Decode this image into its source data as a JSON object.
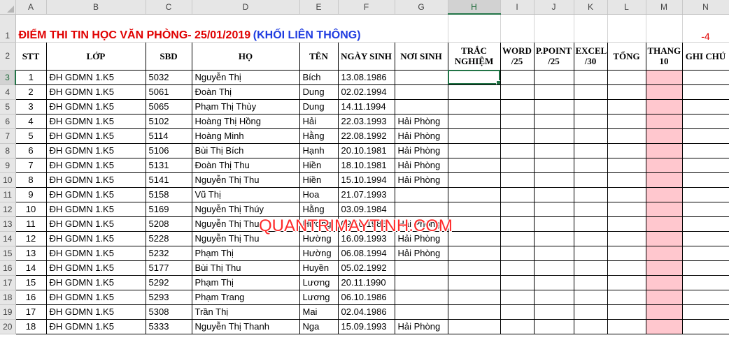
{
  "columns": [
    "A",
    "B",
    "C",
    "D",
    "E",
    "F",
    "G",
    "H",
    "I",
    "J",
    "K",
    "L",
    "M",
    "N"
  ],
  "selected_column": "H",
  "row_numbers": [
    "1",
    "2",
    "3",
    "4",
    "5",
    "6",
    "7",
    "8",
    "9",
    "10",
    "11",
    "12",
    "13",
    "14",
    "15",
    "16",
    "17",
    "18",
    "19",
    "20"
  ],
  "selected_row": "3",
  "title": {
    "red_part": "ĐIỂM THI TIN HỌC VĂN PHÒNG- 25/01/2019",
    "blue_part": "(KHỐI LIÊN THÔNG)",
    "n1_value": "-4"
  },
  "headers": [
    "STT",
    "LỚP",
    "SBD",
    "HỌ",
    "TÊN",
    "NGÀY SINH",
    "NƠI SINH",
    "TRẮC NGHIỆM",
    "WORD /25",
    "P.POINT /25",
    "EXCEL /30",
    "TỔNG",
    "THANG 10",
    "GHI CHÚ"
  ],
  "rows": [
    [
      "1",
      "ĐH GDMN 1.K5",
      "5032",
      "Nguyễn Thị",
      "Bích",
      "13.08.1986",
      ""
    ],
    [
      "2",
      "ĐH GDMN 1.K5",
      "5061",
      "Đoàn Thị",
      "Dung",
      "02.02.1994",
      ""
    ],
    [
      "3",
      "ĐH GDMN 1.K5",
      "5065",
      "Phạm Thị Thùy",
      "Dung",
      "14.11.1994",
      ""
    ],
    [
      "4",
      "ĐH GDMN 1.K5",
      "5102",
      "Hoàng Thị Hồng",
      "Hải",
      "22.03.1993",
      "Hải Phòng"
    ],
    [
      "5",
      "ĐH GDMN 1.K5",
      "5114",
      "Hoàng Minh",
      "Hằng",
      "22.08.1992",
      "Hải Phòng"
    ],
    [
      "6",
      "ĐH GDMN 1.K5",
      "5106",
      "Bùi Thị Bích",
      "Hạnh",
      "20.10.1981",
      "Hải Phòng"
    ],
    [
      "7",
      "ĐH GDMN 1.K5",
      "5131",
      "Đoàn Thị Thu",
      "Hiền",
      "18.10.1981",
      "Hải Phòng"
    ],
    [
      "8",
      "ĐH GDMN 1.K5",
      "5141",
      "Nguyễn Thị Thu",
      "Hiền",
      "15.10.1994",
      "Hải Phòng"
    ],
    [
      "9",
      "ĐH GDMN 1.K5",
      "5158",
      "Vũ Thị",
      "Hoa",
      "21.07.1993",
      ""
    ],
    [
      "10",
      "ĐH GDMN 1.K5",
      "5169",
      "Nguyễn Thị Thúy",
      "Hằng",
      "03.09.1984",
      ""
    ],
    [
      "11",
      "ĐH GDMN 1.K5",
      "5208",
      "Nguyễn Thị Thu",
      "Hương",
      "09.10.1986",
      "Hải Phòng"
    ],
    [
      "12",
      "ĐH GDMN 1.K5",
      "5228",
      "Nguyễn Thị Thu",
      "Hường",
      "16.09.1993",
      "Hải Phòng"
    ],
    [
      "13",
      "ĐH GDMN 1.K5",
      "5232",
      "Phạm Thị",
      "Hường",
      "06.08.1994",
      "Hải Phòng"
    ],
    [
      "14",
      "ĐH GDMN 1.K5",
      "5177",
      "Bùi Thị Thu",
      "Huyền",
      "05.02.1992",
      ""
    ],
    [
      "15",
      "ĐH GDMN 1.K5",
      "5292",
      "Phạm Thị",
      "Lương",
      "20.11.1990",
      ""
    ],
    [
      "16",
      "ĐH GDMN 1.K5",
      "5293",
      "Phạm Trang",
      "Lương",
      "06.10.1986",
      ""
    ],
    [
      "17",
      "ĐH GDMN 1.K5",
      "5308",
      "Trần Thị",
      "Mai",
      "02.04.1986",
      ""
    ],
    [
      "18",
      "ĐH GDMN 1.K5",
      "5333",
      "Nguyễn Thị Thanh",
      "Nga",
      "15.09.1993",
      "Hải Phòng"
    ]
  ],
  "watermark": "QUANTRIMAYTINH.COM",
  "colors": {
    "title_red": "#e00000",
    "title_blue": "#1f3ce0",
    "highlight_pink": "#ffc7ce",
    "selection_green": "#217346"
  }
}
